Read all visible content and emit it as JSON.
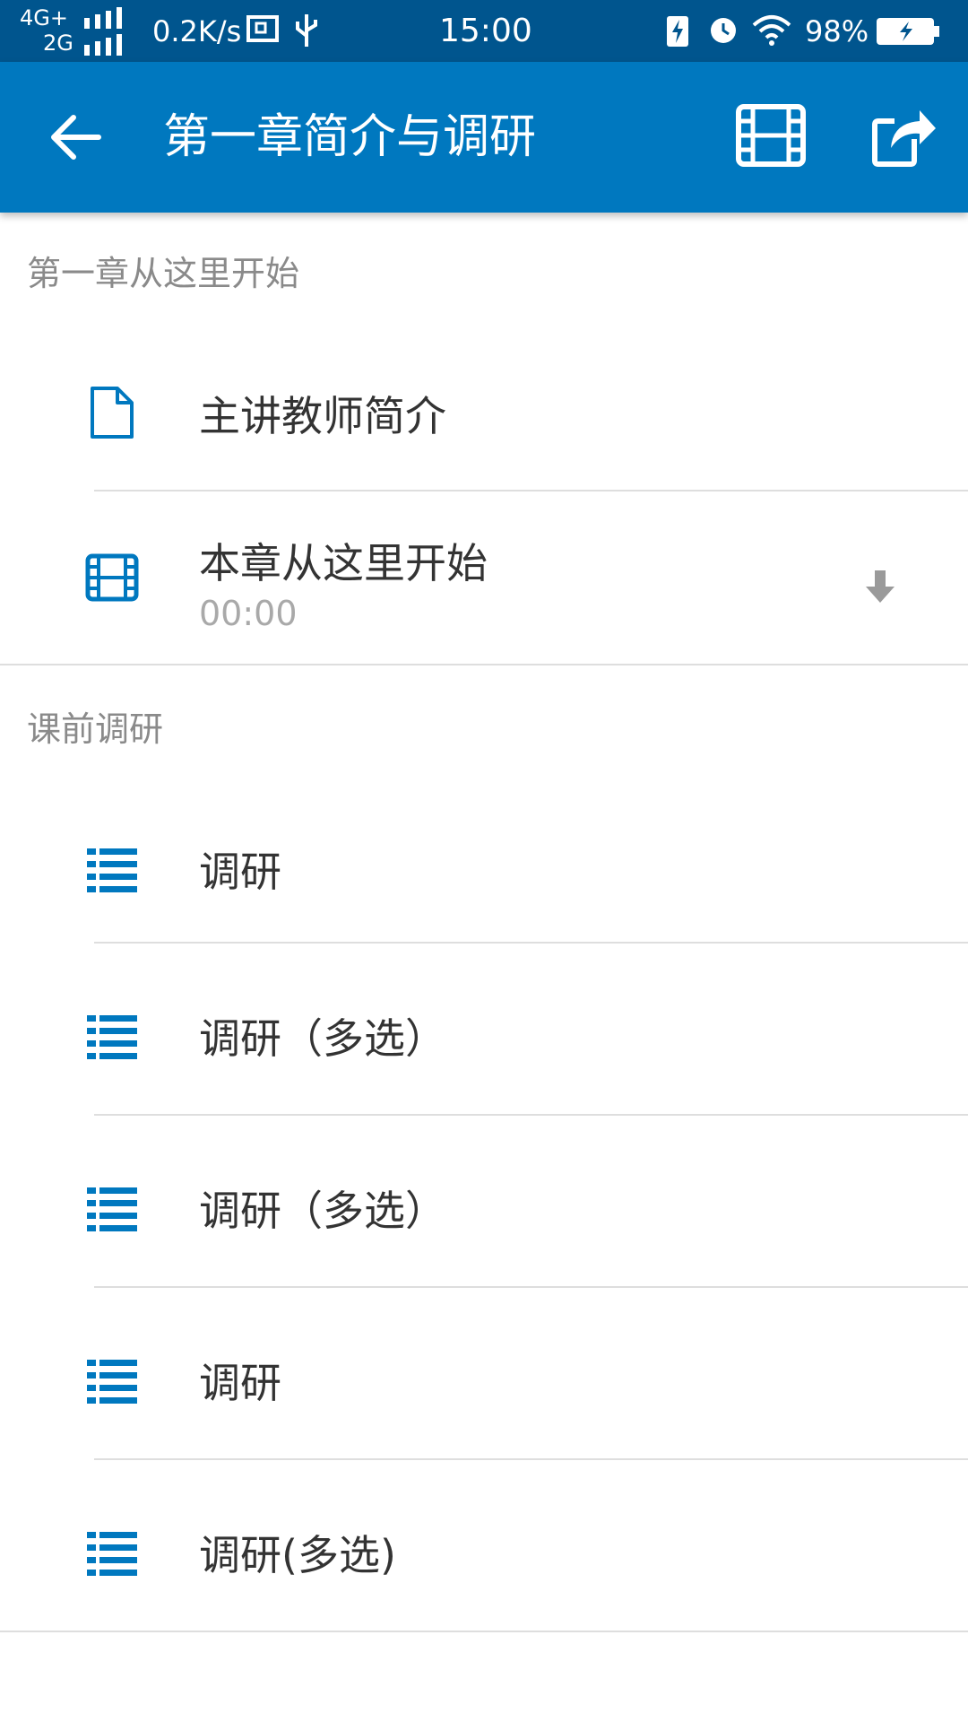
{
  "status_bar": {
    "network_top": "4G+",
    "network_bottom": "2G",
    "speed": "0.2K/s",
    "time": "15:00",
    "battery": "98%"
  },
  "app_bar": {
    "title": "第一章简介与调研",
    "back_icon": "arrow-left-icon",
    "video_icon": "film-icon",
    "share_icon": "share-icon"
  },
  "colors": {
    "status_bar": "#00558e",
    "app_bar": "#0078bf",
    "accent": "#0078bf"
  },
  "sections": [
    {
      "header": "第一章从这里开始",
      "items": [
        {
          "label": "主讲教师简介",
          "icon": "document-icon"
        },
        {
          "label": "本章从这里开始",
          "sub": "00:00",
          "icon": "film-icon",
          "action_icon": "download-icon"
        }
      ]
    },
    {
      "header": "课前调研",
      "items": [
        {
          "label": "调研",
          "icon": "list-icon"
        },
        {
          "label": "调研（多选）",
          "icon": "list-icon"
        },
        {
          "label": "调研（多选）",
          "icon": "list-icon"
        },
        {
          "label": "调研",
          "icon": "list-icon"
        },
        {
          "label": "调研(多选)",
          "icon": "list-icon"
        }
      ]
    }
  ]
}
